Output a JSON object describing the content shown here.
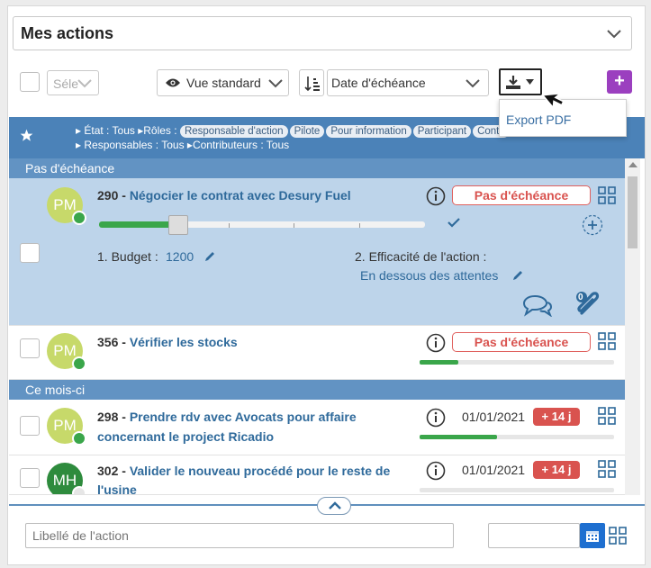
{
  "header": {
    "title": "Mes actions"
  },
  "toolbar": {
    "select_placeholder": "Séle",
    "view_label": "Vue standard",
    "sort_label": "Date d'échéance",
    "add_label": "+"
  },
  "export_menu": {
    "items": [
      "Export PDF"
    ]
  },
  "filters": {
    "etat_label": "État",
    "etat_value": "Tous",
    "roles_label": "Rôles",
    "roles": [
      "Responsable d'action",
      "Pilote",
      "Pour information",
      "Participant",
      "Contri"
    ],
    "responsables_label": "Responsables",
    "responsables_value": "Tous",
    "contributeurs_label": "Contributeurs",
    "contributeurs_value": "Tous"
  },
  "sections": [
    {
      "title": "Pas d'échéance"
    },
    {
      "title": "Ce mois-ci"
    }
  ],
  "actions": [
    {
      "id": "290",
      "title": "Négocier le contrat avec Desury Fuel",
      "initials": "PM",
      "status": "Pas d'échéance",
      "progress": 0.24,
      "field1_label": "1. Budget :",
      "field1_value": "1200",
      "field2_label": "2. Efficacité de l'action :",
      "field2_value": "En dessous des attentes",
      "attachments": "0"
    },
    {
      "id": "356",
      "title": "Vérifier les stocks",
      "initials": "PM",
      "status": "Pas d'échéance",
      "progress": 0.2
    },
    {
      "id": "298",
      "title_line1": "Prendre rdv avec Avocats pour affaire",
      "title_line2": "concernant le project Ricadio",
      "initials": "PM",
      "date": "01/01/2021",
      "delay": "+ 14 j",
      "progress": 0.4
    },
    {
      "id": "302",
      "title_line1": "Valider le nouveau procédé pour le reste de",
      "title_line2": "l'usine",
      "initials": "MH",
      "date": "01/01/2021",
      "delay": "+ 14 j",
      "progress": 0
    }
  ],
  "footer": {
    "label_placeholder": "Libellé de l'action"
  },
  "colors": {
    "accent": "#4b82b8",
    "purple": "#9b3fbf",
    "danger": "#d9534f",
    "avatar_pm": "#c7d96a",
    "avatar_mh": "#2e8b3d",
    "online": "#3aa64a"
  }
}
